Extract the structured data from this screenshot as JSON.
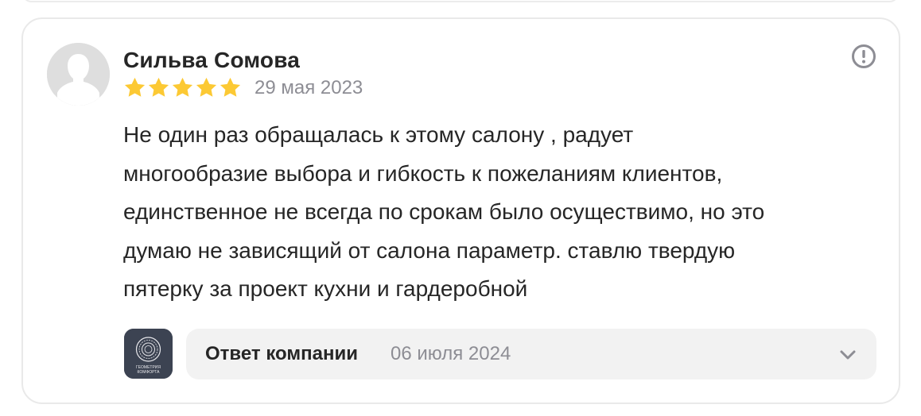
{
  "review": {
    "author": "Сильва Сомова",
    "rating": 5,
    "max_rating": 5,
    "date": "29 мая 2023",
    "text": "Не один раз обращалась к этому салону , радует многообразие выбора и гибкость к пожеланиям клиентов, единственное не всегда по срокам было осуществимо, но это думаю не зависящий от салона параметр. ставлю твердую пятерку за проект кухни и гардеробной",
    "text_lines": [
      "Не один раз обращалась к этому салону , радует",
      "многообразие выбора и гибкость к пожеланиям клиентов,",
      "единственное не всегда по срокам было осуществимо, но это",
      "думаю не зависящий от салона параметр. ставлю твердую",
      "пятерку за проект кухни и гардеробной"
    ]
  },
  "company_answer": {
    "label": "Ответ компании",
    "date": "06 июля 2024",
    "logo_text": [
      "ГЕОМЕТРИЯ",
      "КОМФОРТА"
    ]
  },
  "colors": {
    "star": "#fcc934",
    "text": "#262626",
    "muted": "#8d8d94",
    "avatar_bg": "#dedede",
    "answer_bg": "#f2f2f2",
    "logo_bg": "#3c4352"
  },
  "icons": {
    "report": "exclamation-circle-icon",
    "chevron": "chevron-down-icon",
    "star": "star-icon",
    "avatar": "user-silhouette-icon"
  }
}
